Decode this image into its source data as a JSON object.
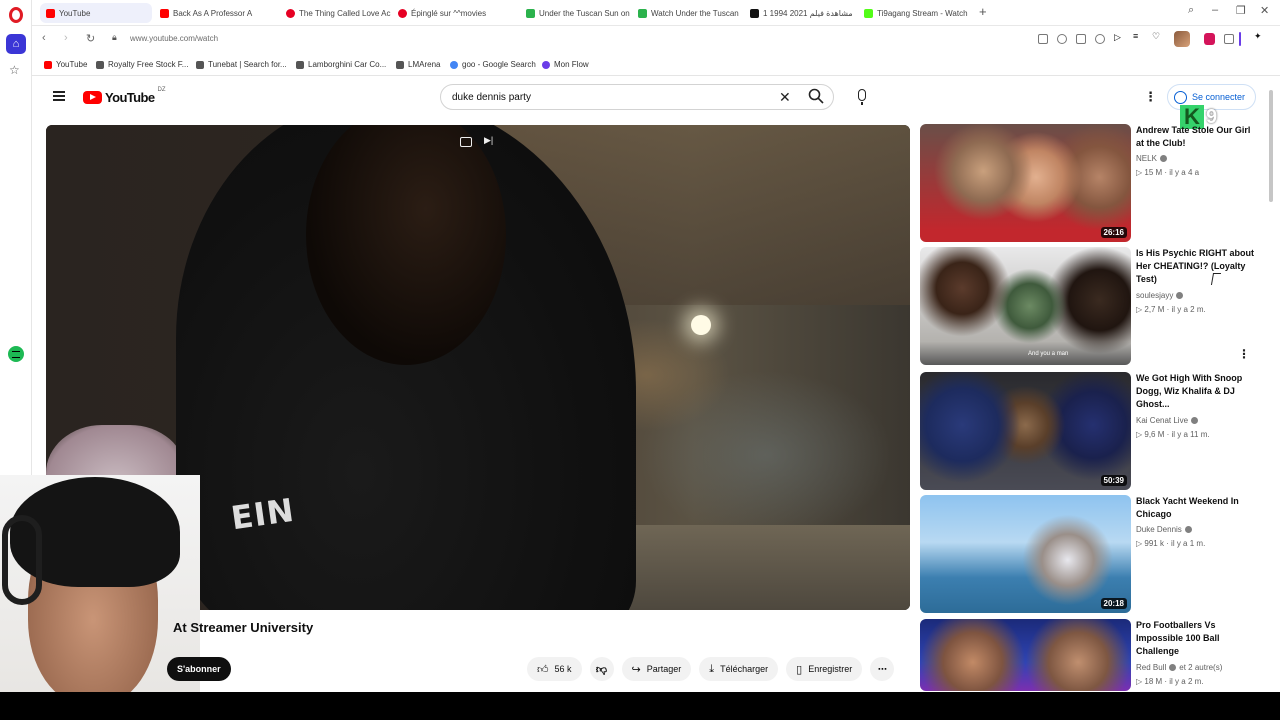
{
  "browser": {
    "tabs": [
      {
        "label": "YouTube",
        "color": "#ff0000"
      },
      {
        "label": "Back As A Professor A",
        "color": "#ff0000"
      },
      {
        "label": "The Thing Called Love Ac",
        "color": "#e60023"
      },
      {
        "label": "Épinglé sur ^^movies",
        "color": "#e60023"
      },
      {
        "label": "Under the Tuscan Sun on",
        "color": "#2bb24c"
      },
      {
        "label": "Watch Under the Tuscan",
        "color": "#2bb24c"
      },
      {
        "label": "1 1994 2021 مشاهدة فيلم",
        "color": "#111111"
      },
      {
        "label": "Ti9agang Stream - Watch",
        "color": "#53fc18"
      }
    ],
    "new_tab": "+",
    "url": "www.youtube.com/watch",
    "bookmarks": [
      {
        "label": "YouTube",
        "color": "#ff0000"
      },
      {
        "label": "Royalty Free Stock F...",
        "color": "#555555"
      },
      {
        "label": "Tunebat | Search for...",
        "color": "#555555"
      },
      {
        "label": "Lamborghini Car Co...",
        "color": "#555555"
      },
      {
        "label": "LMArena",
        "color": "#555555"
      },
      {
        "label": "goo - Google Search",
        "color": "#4285f4"
      },
      {
        "label": "Mon Flow",
        "color": "#6a3de8"
      }
    ]
  },
  "youtube": {
    "logo_text": "YouTube",
    "country_code": "DZ",
    "search_value": "duke dennis party",
    "sign_in": "Se connecter",
    "video_title": "At Streamer University",
    "subscribe": "S'abonner",
    "likes": "56 k",
    "share": "Partager",
    "download": "Télécharger",
    "save": "Enregistrer",
    "shirt_text": "EIN"
  },
  "badge": {
    "letter": "K",
    "count": "9"
  },
  "recommendations": [
    {
      "title": "Andrew Tate Stole Our Girl at the Club!",
      "channel": "NELK",
      "verified": true,
      "meta": "15 M · il y a 4 a",
      "duration": "26:16"
    },
    {
      "title": "Is His Psychic RIGHT about Her CHEATING!? (Loyalty Test)",
      "channel": "soulesjayy",
      "verified": true,
      "meta": "2,7 M · il y a 2 m.",
      "duration": "",
      "caption": "And you a man"
    },
    {
      "title": "We Got High With Snoop Dogg, Wiz Khalifa & DJ Ghost...",
      "channel": "Kai Cenat Live",
      "verified": true,
      "meta": "9,6 M · il y a 11 m.",
      "duration": "50:39"
    },
    {
      "title": "Black Yacht Weekend In Chicago",
      "channel": "Duke Dennis",
      "verified": true,
      "meta": "991 k · il y a 1 m.",
      "duration": "20:18"
    },
    {
      "title": "Pro Footballers Vs Impossible 100 Ball Challenge",
      "channel": "Red Bull",
      "verified": true,
      "channel_extra": "et 2 autre(s)",
      "meta": "18 M · il y a 2 m.",
      "duration": ""
    }
  ]
}
